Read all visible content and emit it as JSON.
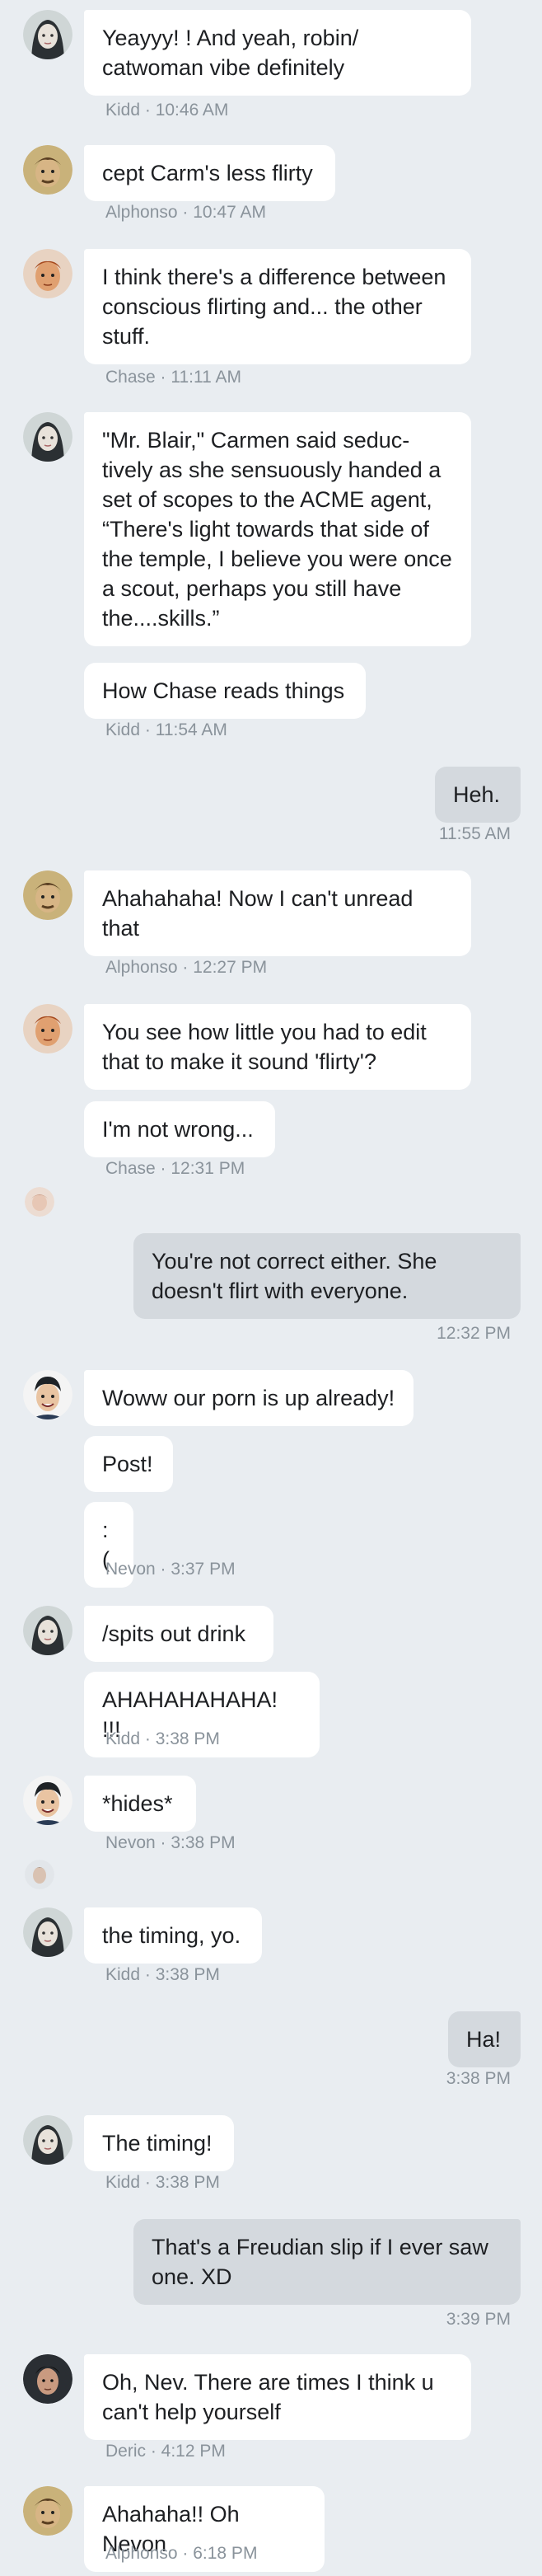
{
  "messages": [
    {
      "id": "m1",
      "text": "Yeayyy! ! And yeah, robin/ catwoman vibe definitely"
    },
    {
      "id": "m2",
      "text": "cept Carm's less flirty"
    },
    {
      "id": "m3",
      "text": "I think there's a difference between conscious flirting and... the other stuff."
    },
    {
      "id": "m4",
      "text": "\"Mr. Blair,\" Carmen said seduc- tively as she sensuously handed a set of scopes to the ACME agent, “There's light towards that side of the temple, I believe you were once a scout, perhaps you still have the....skills.”"
    },
    {
      "id": "m5",
      "text": "How Chase reads things"
    },
    {
      "id": "m6",
      "text": "Heh."
    },
    {
      "id": "m7",
      "text": "Ahahahaha! Now I can't unread that"
    },
    {
      "id": "m8",
      "text": "You see how little you had to edit that to make it sound 'flirty'?"
    },
    {
      "id": "m9",
      "text": "I'm not wrong..."
    },
    {
      "id": "m10",
      "text": "You're not correct either. She doesn't flirt with everyone."
    },
    {
      "id": "m11",
      "text": "Woww our porn is up already!"
    },
    {
      "id": "m12",
      "text": "Post!"
    },
    {
      "id": "m13",
      "text": ":("
    },
    {
      "id": "m14",
      "text": "/spits out drink"
    },
    {
      "id": "m15",
      "text": "AHAHAHAHAHA! !!!"
    },
    {
      "id": "m16",
      "text": "*hides*"
    },
    {
      "id": "m17",
      "text": "the timing, yo."
    },
    {
      "id": "m18",
      "text": "Ha!"
    },
    {
      "id": "m19",
      "text": "The timing!"
    },
    {
      "id": "m20",
      "text": "That's a Freudian slip if I ever saw one. XD"
    },
    {
      "id": "m21",
      "text": "Oh, Nev. There are times I think u can't help yourself"
    },
    {
      "id": "m22",
      "text": "Ahahaha!! Oh Nevon"
    }
  ],
  "meta": {
    "t1": "Kidd · 10:46 AM",
    "t2": "Alphonso · 10:47 AM",
    "t3": "Chase · 11:11 AM",
    "t4": "Kidd · 11:54 AM",
    "t5": "11:55 AM",
    "t6": "Alphonso · 12:27 PM",
    "t7": "Chase · 12:31 PM",
    "t8": "12:32 PM",
    "t9": "Nevon · 3:37 PM",
    "t10": "Kidd · 3:38 PM",
    "t11": "Nevon · 3:38 PM",
    "t12": "Kidd · 3:38 PM",
    "t13": "3:38 PM",
    "t14": "Kidd · 3:38 PM",
    "t15": "3:39 PM",
    "t16": "Deric · 4:12 PM",
    "t17": "Alphonso · 6:18 PM"
  },
  "avatars": {
    "kidd": "kidd-avatar",
    "alphonso": "alphonso-avatar",
    "chase": "chase-avatar",
    "nevon": "nevon-avatar",
    "deric": "deric-avatar",
    "read_receipt": "read-receipt-avatar"
  },
  "colors": {
    "background": "#e9edf1",
    "incoming_bubble": "#ffffff",
    "outgoing_bubble": "#d4d9de",
    "meta_text": "#8a939b"
  }
}
